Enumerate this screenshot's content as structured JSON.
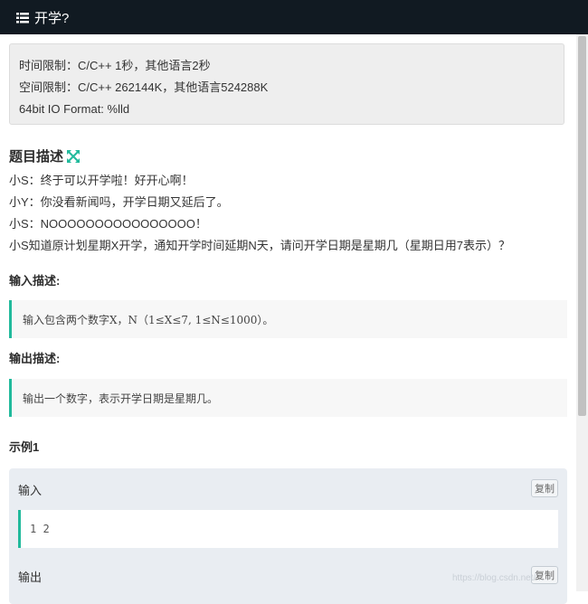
{
  "header": {
    "icon": "list-icon",
    "title": "开学?"
  },
  "limits": {
    "time": "时间限制：C/C++ 1秒，其他语言2秒",
    "space": "空间限制：C/C++ 262144K，其他语言524288K",
    "io_format": "64bit IO Format: %lld"
  },
  "description": {
    "title": "题目描述",
    "expand_icon": "expand-icon",
    "lines": [
      "小S：终于可以开学啦！好开心啊！",
      "小Y：你没看新闻吗，开学日期又延后了。",
      "小S：NOOOOOOOOOOOOOOOO！",
      "小S知道原计划星期X开学，通知开学时间延期N天，请问开学日期是星期几（星期日用7表示）？"
    ]
  },
  "input": {
    "title": "输入描述:",
    "text": "输入包含两个数字X，N（1≤X≤7, 1≤N≤1000）。"
  },
  "output": {
    "title": "输出描述:",
    "text": "输出一个数字，表示开学日期是星期几。"
  },
  "example": {
    "title": "示例1",
    "input_label": "输入",
    "input_value": "1 2",
    "output_label": "输出",
    "copy_label": "复制"
  },
  "watermark": "https://blog.csdn.net/...",
  "colors": {
    "topbar": "#111a22",
    "accent": "#21ba9c",
    "example_bg": "#e9edf2"
  }
}
